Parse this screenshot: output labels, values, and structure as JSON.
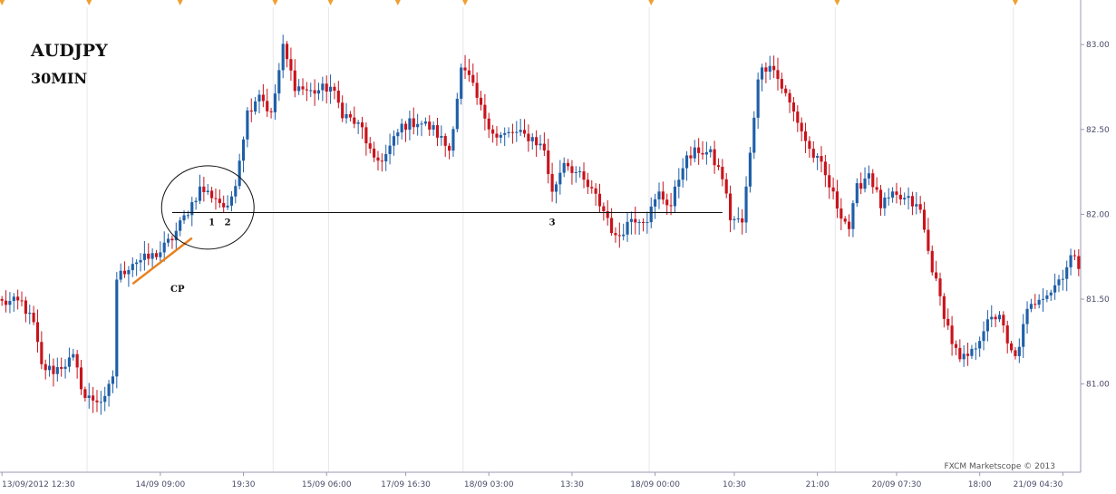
{
  "chart_data": {
    "type": "candlestick",
    "title": "AUDJPY",
    "subtitle": "30MIN",
    "watermark": "FXCM Marketscope © 2013",
    "ylim": [
      80.48,
      83.22
    ],
    "y_ticks": [
      81.0,
      81.5,
      82.0,
      82.5,
      83.0
    ],
    "y_tick_labels": [
      "81.00",
      "81.50",
      "82.00",
      "82.50",
      "83.00"
    ],
    "x_ticks": [
      {
        "label": "13/09/2012 12:30",
        "index": 0
      },
      {
        "label": "14/09 09:00",
        "index": 40
      },
      {
        "label": "19:30",
        "index": 61
      },
      {
        "label": "15/09 06:00",
        "index": 82
      },
      {
        "label": "17/09 16:30",
        "index": 102
      },
      {
        "label": "18/09 03:00",
        "index": 123
      },
      {
        "label": "13:30",
        "index": 144
      },
      {
        "label": "18/09 00:00",
        "index": 165
      },
      {
        "label": "10:30",
        "index": 185
      },
      {
        "label": "21:00",
        "index": 206
      },
      {
        "label": "20/09 07:30",
        "index": 226
      },
      {
        "label": "18:00",
        "index": 247
      },
      {
        "label": "21/09 04:30",
        "index": 268
      }
    ],
    "separator_indices": [
      22,
      69,
      83,
      117,
      164,
      211,
      256
    ],
    "colors": {
      "up": "#1f5fa8",
      "down": "#c8141c",
      "annotation_line": "#e8801e",
      "level": "#111111",
      "tick_text": "#4a4a6a"
    },
    "support_level": {
      "price": 82.01,
      "start_index": 43,
      "end_index": 182
    },
    "trendline": {
      "from": {
        "index": 33,
        "price": 81.59
      },
      "to": {
        "index": 48,
        "price": 81.86
      },
      "label": "CP"
    },
    "circle": {
      "center_index": 52,
      "center_price": 82.04,
      "label_1": "1",
      "label_2": "2"
    },
    "markers": [
      {
        "label": "1",
        "index": 53
      },
      {
        "label": "2",
        "index": 57
      },
      {
        "label": "3",
        "index": 139
      }
    ],
    "anchor_points": [
      [
        0,
        81.48
      ],
      [
        5,
        81.48
      ],
      [
        8,
        81.35
      ],
      [
        10,
        81.1
      ],
      [
        13,
        81.08
      ],
      [
        18,
        81.15
      ],
      [
        21,
        80.92
      ],
      [
        26,
        80.9
      ],
      [
        28,
        81.05
      ],
      [
        29,
        81.62
      ],
      [
        33,
        81.72
      ],
      [
        37,
        81.74
      ],
      [
        40,
        81.78
      ],
      [
        43,
        81.86
      ],
      [
        46,
        81.98
      ],
      [
        50,
        82.15
      ],
      [
        54,
        82.1
      ],
      [
        57,
        82.02
      ],
      [
        59,
        82.2
      ],
      [
        62,
        82.6
      ],
      [
        65,
        82.72
      ],
      [
        68,
        82.58
      ],
      [
        71,
        82.98
      ],
      [
        74,
        82.76
      ],
      [
        78,
        82.72
      ],
      [
        83,
        82.75
      ],
      [
        86,
        82.6
      ],
      [
        91,
        82.5
      ],
      [
        94,
        82.3
      ],
      [
        97,
        82.35
      ],
      [
        101,
        82.52
      ],
      [
        105,
        82.55
      ],
      [
        109,
        82.5
      ],
      [
        113,
        82.38
      ],
      [
        116,
        82.85
      ],
      [
        118,
        82.8
      ],
      [
        121,
        82.62
      ],
      [
        125,
        82.45
      ],
      [
        129,
        82.48
      ],
      [
        134,
        82.45
      ],
      [
        137,
        82.38
      ],
      [
        139,
        82.12
      ],
      [
        142,
        82.32
      ],
      [
        146,
        82.22
      ],
      [
        150,
        82.1
      ],
      [
        153,
        81.98
      ],
      [
        155,
        81.85
      ],
      [
        159,
        81.98
      ],
      [
        163,
        81.98
      ],
      [
        166,
        82.12
      ],
      [
        169,
        82.05
      ],
      [
        172,
        82.3
      ],
      [
        176,
        82.38
      ],
      [
        179,
        82.35
      ],
      [
        182,
        82.22
      ],
      [
        184,
        81.98
      ],
      [
        187,
        81.95
      ],
      [
        189,
        82.35
      ],
      [
        191,
        82.82
      ],
      [
        194,
        82.9
      ],
      [
        197,
        82.75
      ],
      [
        201,
        82.55
      ],
      [
        204,
        82.38
      ],
      [
        207,
        82.28
      ],
      [
        211,
        82.05
      ],
      [
        214,
        81.92
      ],
      [
        216,
        82.15
      ],
      [
        219,
        82.25
      ],
      [
        222,
        82.05
      ],
      [
        225,
        82.1
      ],
      [
        229,
        82.08
      ],
      [
        232,
        82.02
      ],
      [
        234,
        81.78
      ],
      [
        237,
        81.5
      ],
      [
        240,
        81.25
      ],
      [
        242,
        81.13
      ],
      [
        245,
        81.18
      ],
      [
        248,
        81.33
      ],
      [
        252,
        81.42
      ],
      [
        254,
        81.22
      ],
      [
        256,
        81.15
      ],
      [
        259,
        81.42
      ],
      [
        262,
        81.52
      ],
      [
        265,
        81.55
      ],
      [
        268,
        81.65
      ],
      [
        270,
        81.75
      ],
      [
        272,
        81.7
      ]
    ]
  }
}
